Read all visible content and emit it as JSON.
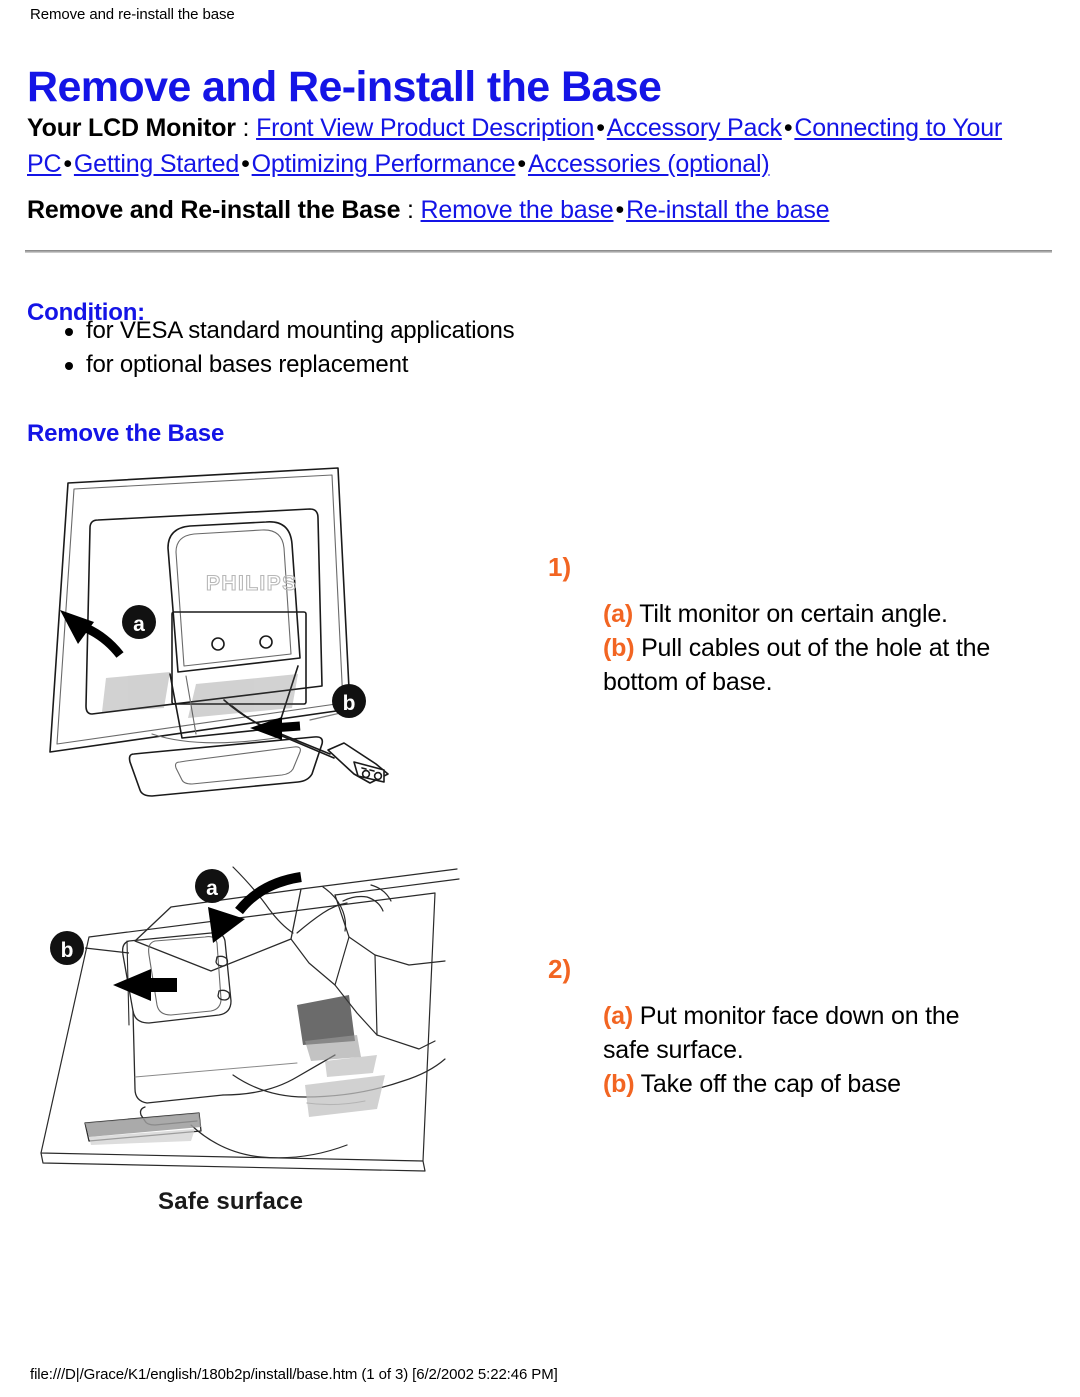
{
  "header": {
    "breadcrumb_note": "Remove and re-install the base",
    "title": "Remove and Re-install the Base"
  },
  "nav_primary": {
    "label": "Your LCD Monitor",
    "separator": " : ",
    "bullet": "•",
    "links": [
      "Front View Product Description",
      "Accessory Pack",
      "Connecting to Your PC",
      "Getting Started",
      "Optimizing Performance",
      "Accessories (optional)"
    ]
  },
  "nav_secondary": {
    "label": "Remove and Re-install the Base",
    "separator": " : ",
    "bullet": "•",
    "links": [
      "Remove the base",
      "Re-install the base"
    ]
  },
  "condition": {
    "heading": "Condition:",
    "items": [
      "for VESA standard mounting applications",
      "for optional bases replacement"
    ]
  },
  "section": {
    "remove_base_heading": "Remove the Base"
  },
  "figures": {
    "figure_1": {
      "brand_logo_text": "PHILIPS",
      "callout_a": "a",
      "callout_b": "b"
    },
    "figure_2": {
      "callout_a": "a",
      "callout_b": "b",
      "caption": "Safe surface"
    }
  },
  "steps": [
    {
      "number": "1)",
      "lines": [
        {
          "marker": "(a)",
          "text": " Tilt monitor on certain angle."
        },
        {
          "marker": "(b)",
          "text": " Pull cables out of the hole at the bottom of base."
        }
      ],
      "marker_a": "(a)",
      "text_a": " Tilt monitor on certain angle.",
      "marker_b": "(b)",
      "text_b": " Pull cables out of the hole at the bottom of base."
    },
    {
      "number": "2)",
      "marker_a": "(a)",
      "text_a": " Put monitor face down on the safe surface.",
      "marker_b": "(b)",
      "text_b": " Take off the cap of base"
    }
  ],
  "footer": {
    "path": "file:///D|/Grace/K1/english/180b2p/install/base.htm (1 of 3) [6/2/2002 5:22:46 PM]"
  },
  "colors": {
    "link_blue": "#1414e6",
    "heading_blue": "#1414e6",
    "marker_orange": "#f26522",
    "text_black": "#000000",
    "rule_gray": "#a8a8a8"
  }
}
